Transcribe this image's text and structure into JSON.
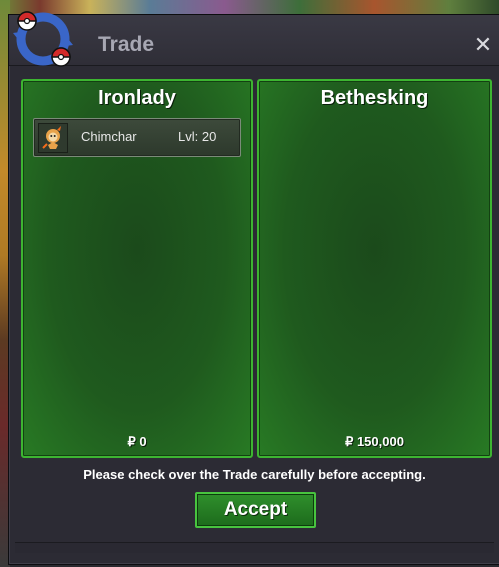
{
  "window": {
    "title": "Trade",
    "close_glyph": "✕"
  },
  "left_panel": {
    "player_name": "Ironlady",
    "items": [
      {
        "pokemon": "Chimchar",
        "level": "Lvl: 20",
        "icon": "chimchar-icon"
      }
    ],
    "money": "₽ 0"
  },
  "right_panel": {
    "player_name": "Bethesking",
    "items": [],
    "money": "₽ 150,000"
  },
  "notice": "Please check over the Trade carefully before accepting.",
  "accept_label": "Accept",
  "colors": {
    "panel_border": "#3db531",
    "panel_fill": "#1f5a1e",
    "button_fill": "#2f8f2c",
    "window_bg": "#2c2b34"
  }
}
